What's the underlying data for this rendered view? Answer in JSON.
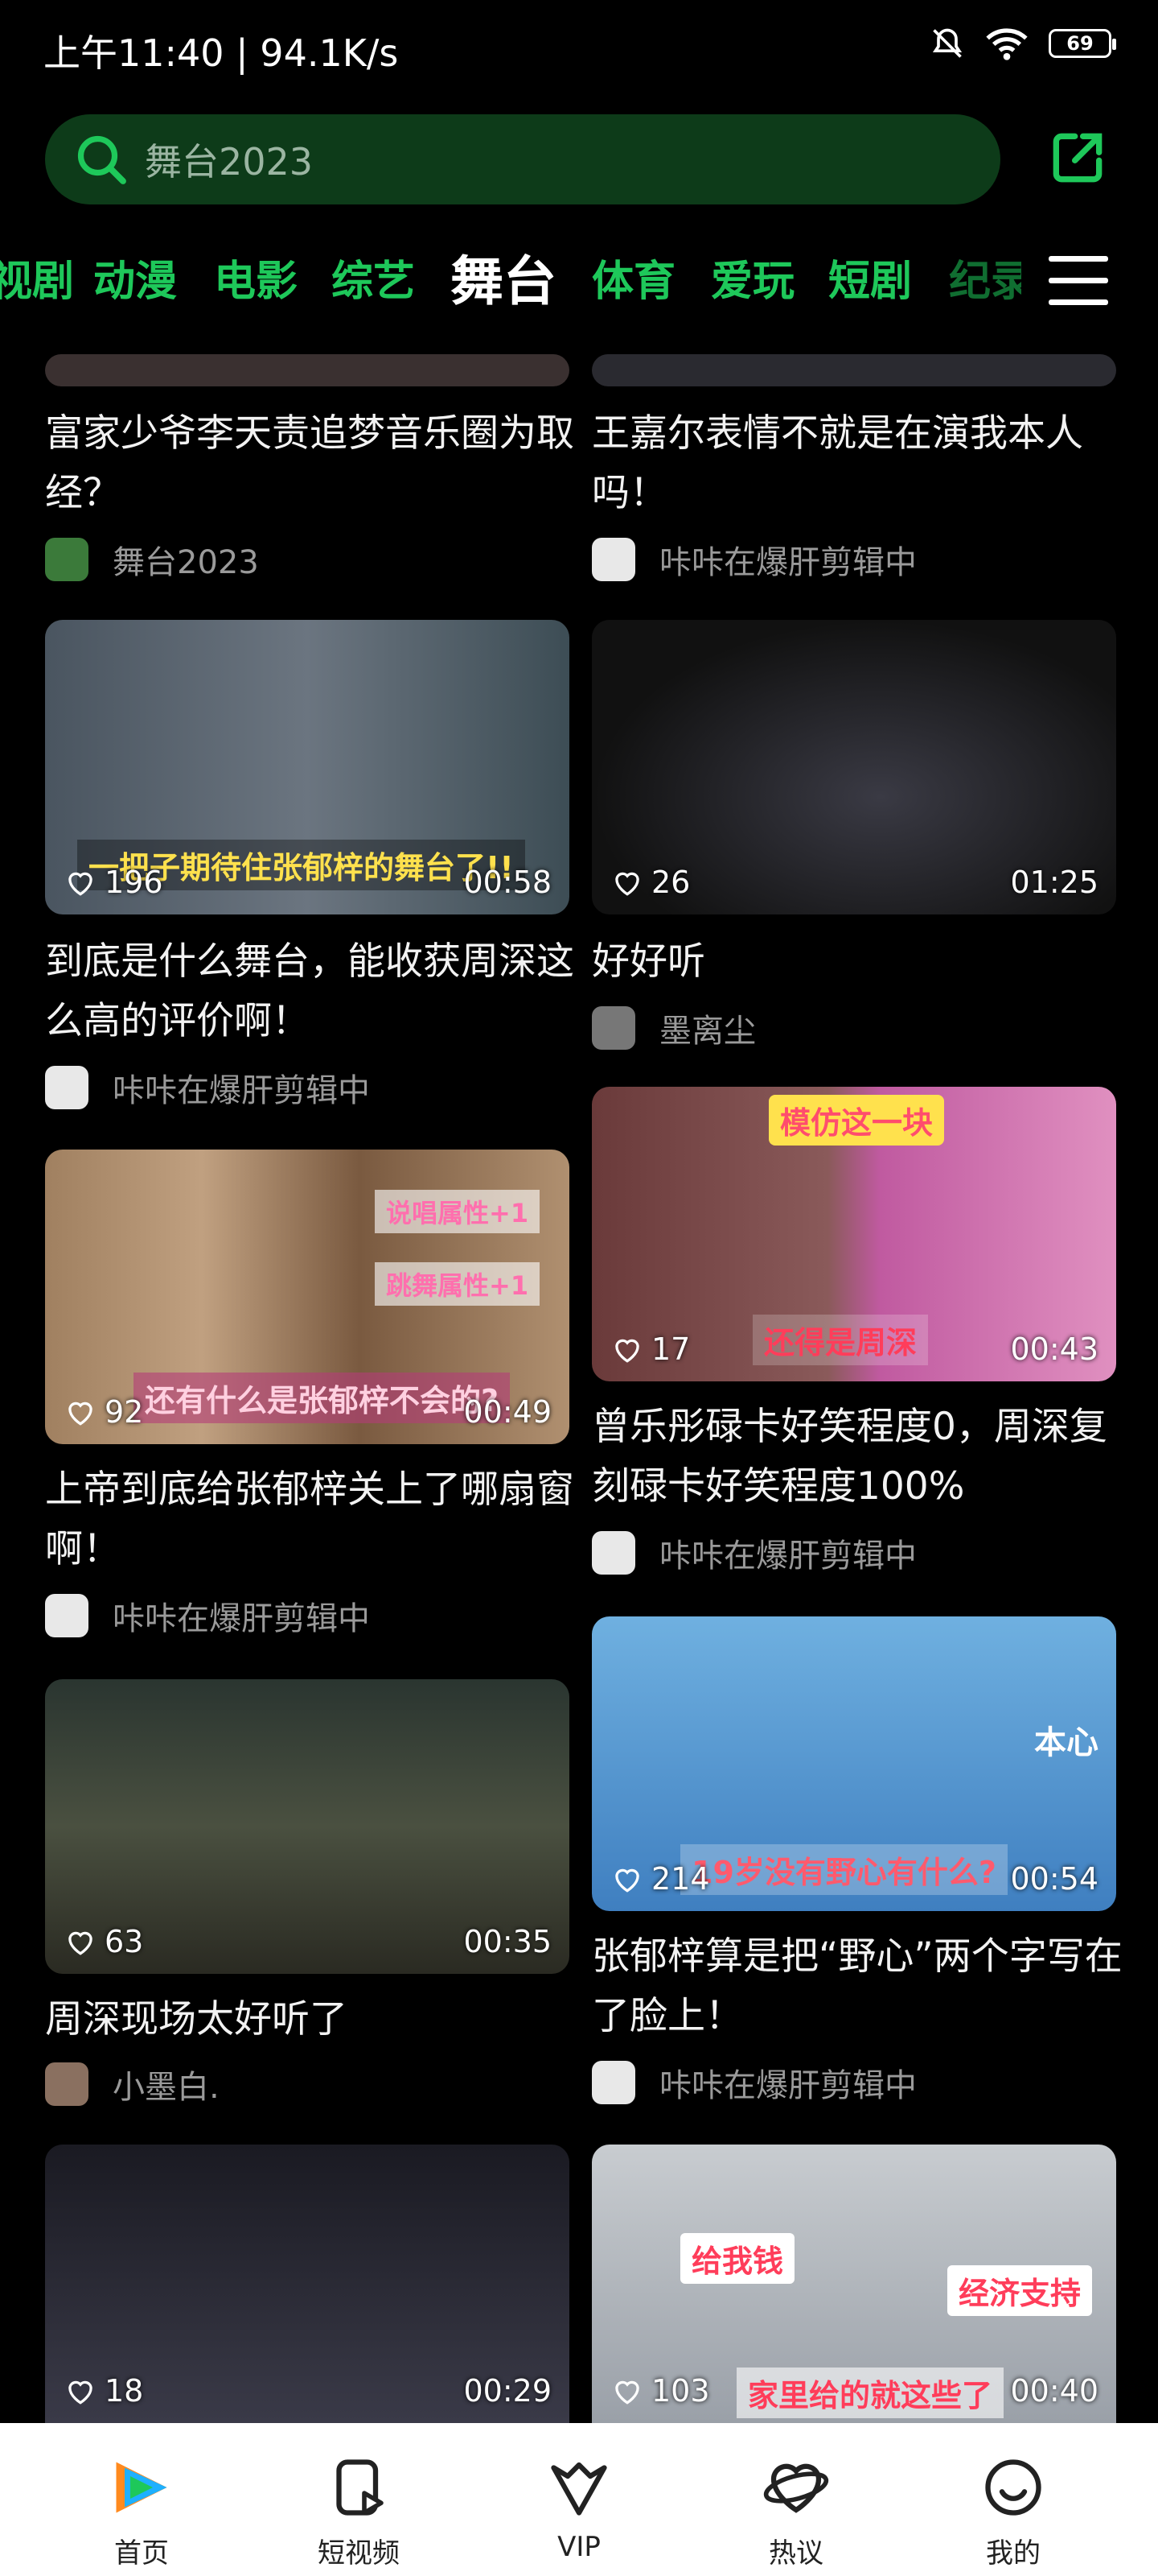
{
  "status_bar": {
    "time": "上午11:40 | 94.1K/s",
    "battery": "69"
  },
  "search": {
    "query": "舞台2023"
  },
  "tabs": [
    {
      "label": "视剧"
    },
    {
      "label": "动漫"
    },
    {
      "label": "电影"
    },
    {
      "label": "综艺"
    },
    {
      "label": "舞台"
    },
    {
      "label": "体育"
    },
    {
      "label": "爱玩"
    },
    {
      "label": "短剧"
    },
    {
      "label": "纪录"
    }
  ],
  "active_tab": "舞台",
  "feed": {
    "top_left": {
      "title": "富家少爷李天责追梦音乐圈为取经？",
      "author": "舞台2023"
    },
    "top_right": {
      "title": "王嘉尔表情不就是在演我本人吗！",
      "author": "咔咔在爆肝剪辑中"
    },
    "cards": [
      {
        "likes": "196",
        "duration": "00:58",
        "title": "到底是什么舞台，能收获周深这么高的评价啊！",
        "author": "咔咔在爆肝剪辑中",
        "overlay": "一把子期待住张郁梓的舞台了!!"
      },
      {
        "likes": "26",
        "duration": "01:25",
        "title": "好好听",
        "author": "墨离尘"
      },
      {
        "likes": "17",
        "duration": "00:43",
        "title": "曾乐彤碌卡好笑程度0，周深复刻碌卡好笑程度100%",
        "author": "咔咔在爆肝剪辑中",
        "overlay_top": "模仿这一块",
        "overlay_bottom": "还得是周深"
      },
      {
        "likes": "92",
        "duration": "00:49",
        "title": "上帝到底给张郁梓关上了哪扇窗啊！",
        "author": "咔咔在爆肝剪辑中",
        "overlay": "还有什么是张郁梓不会的?",
        "tag1": "说唱属性+1",
        "tag2": "跳舞属性+1"
      },
      {
        "likes": "214",
        "duration": "00:54",
        "title": "张郁梓算是把“野心”两个字写在了脸上！",
        "author": "咔咔在爆肝剪辑中",
        "overlay": "19岁没有野心有什么?",
        "tag1": "本心"
      },
      {
        "likes": "63",
        "duration": "00:35",
        "title": "周深现场太好听了",
        "author": "小墨白."
      },
      {
        "likes": "18",
        "duration": "00:29"
      },
      {
        "likes": "103",
        "duration": "00:40",
        "overlay_top": "给我钱",
        "overlay_mid": "经济支持",
        "overlay_bottom": "家里给的就这些了"
      }
    ]
  },
  "bottom_nav": [
    {
      "label": "首页"
    },
    {
      "label": "短视频"
    },
    {
      "label": "VIP"
    },
    {
      "label": "热议"
    },
    {
      "label": "我的"
    }
  ],
  "colors": {
    "accent": "#1ec85a",
    "search_bg": "#0d3b19",
    "nav_bg": "#ffffff"
  }
}
